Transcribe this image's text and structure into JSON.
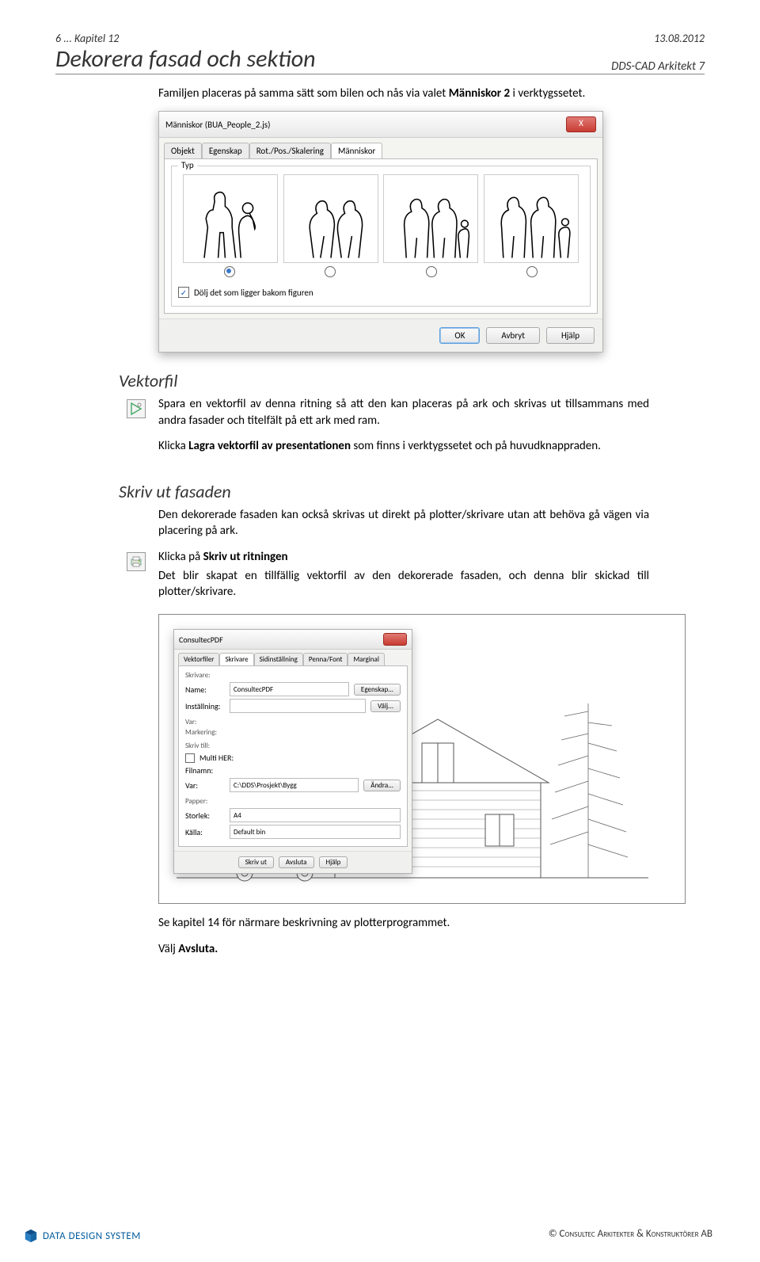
{
  "header": {
    "chapter": "6 ... Kapitel 12",
    "date": "13.08.2012",
    "title": "Dekorera fasad och sektion",
    "subtitle": "DDS-CAD Arkitekt 7"
  },
  "intro": {
    "pre": "Familjen placeras på samma sätt som bilen och nås via valet ",
    "bold": "Människor 2",
    "post": " i verktygssetet."
  },
  "dialog1": {
    "title": "Människor (BUA_People_2.js)",
    "close": "X",
    "tabs": [
      "Objekt",
      "Egenskap",
      "Rot./Pos./Skalering",
      "Människor"
    ],
    "typ_legend": "Typ",
    "hide_label": "Dölj det som ligger bakom figuren",
    "btn_ok": "OK",
    "btn_cancel": "Avbryt",
    "btn_help": "Hjälp"
  },
  "vektorfil": {
    "h": "Vektorfil",
    "p1": "Spara en vektorfil av denna ritning så att den kan placeras på ark och skrivas ut tillsammans med andra fasader och titelfält på ett ark med ram.",
    "p2_pre": "Klicka ",
    "p2_bold": "Lagra vektorfil av presentationen",
    "p2_post": " som finns i verktygssetet och på huvudknappraden."
  },
  "skriv": {
    "h": "Skriv ut fasaden",
    "p1": "Den dekorerade fasaden kan också skrivas ut direkt på plotter/skrivare utan att behöva gå vägen via placering på ark.",
    "p2_pre": "Klicka på ",
    "p2_bold": "Skriv ut ritningen",
    "p3": "Det blir skapat en tillfällig vektorfil av den dekorerade fasaden, och denna blir skickad till plotter/skrivare."
  },
  "print_dlg": {
    "title": "ConsultecPDF",
    "tabs": [
      "Vektorfiler",
      "Skrivare",
      "Sidinställning",
      "Penna/Font",
      "Marginal"
    ],
    "g_skrivare": "Skrivare:",
    "name_lbl": "Name:",
    "name_val": "ConsultecPDF",
    "egenskap": "Egenskap...",
    "install_lbl": "Inställning:",
    "valj": "Välj...",
    "g_var": "Var:",
    "g_markering": "Markering:",
    "skriv_til": "Skriv till:",
    "chk_multi": "Multi HER:",
    "filnamn": "Filnamn:",
    "var_lbl": "Var:",
    "var_val": "C:\\DDS\\Prosjekt\\Bygg",
    "andra": "Ändra...",
    "g_papper": "Papper:",
    "storlek": "Storlek:",
    "storlek_val": "A4",
    "kalla": "Källa:",
    "kalla_val": "Default bin",
    "btn_print": "Skriv ut",
    "btn_cancel": "Avsluta",
    "btn_help": "Hjälp"
  },
  "closing": {
    "p1": "Se kapitel 14 för närmare beskrivning av plotterprogrammet.",
    "p2_pre": "Välj ",
    "p2_bold": "Avsluta."
  },
  "footer": {
    "logo": "DATA DESIGN SYSTEM",
    "right": "© Consultec Arkitekter & Konstruktörer AB"
  }
}
